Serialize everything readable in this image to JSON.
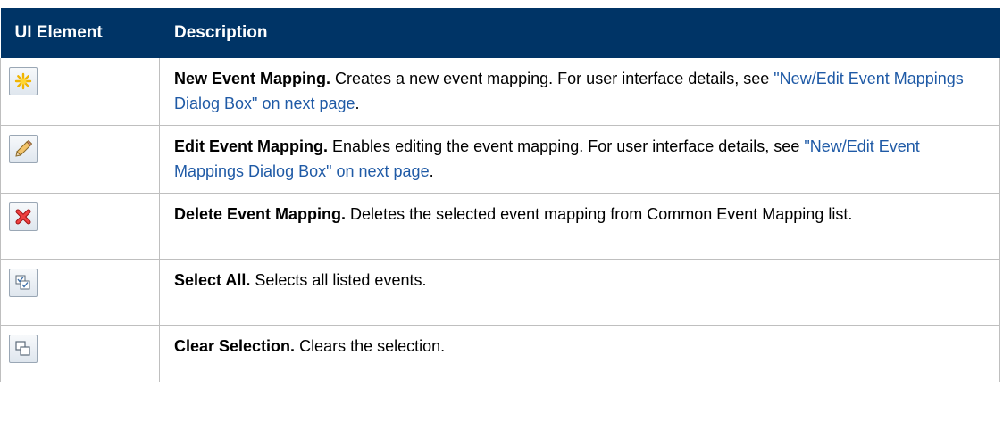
{
  "table": {
    "headers": {
      "ui_element": "UI Element",
      "description": "Description"
    },
    "rows": [
      {
        "icon": "new-star-icon",
        "term": "New Event Mapping.",
        "text": " Creates a new event mapping. For user interface details, see ",
        "link": "\"New/Edit Event Mappings Dialog Box\" on next page",
        "tail": "."
      },
      {
        "icon": "pencil-edit-icon",
        "term": "Edit Event Mapping.",
        "text": " Enables editing the event mapping. For user interface details, see ",
        "link": "\"New/Edit Event Mappings Dialog Box\" on next page",
        "tail": "."
      },
      {
        "icon": "delete-x-icon",
        "term": "Delete Event Mapping.",
        "text": " Deletes the selected event mapping from Common Event Mapping list.",
        "link": "",
        "tail": ""
      },
      {
        "icon": "select-all-icon",
        "term": "Select All.",
        "text": " Selects all listed events.",
        "link": "",
        "tail": ""
      },
      {
        "icon": "clear-selection-icon",
        "term": "Clear Selection.",
        "text": " Clears the selection.",
        "link": "",
        "tail": ""
      }
    ]
  },
  "colors": {
    "header_bg": "#003466",
    "link": "#1f5aa6",
    "border": "#bfbfbf"
  }
}
